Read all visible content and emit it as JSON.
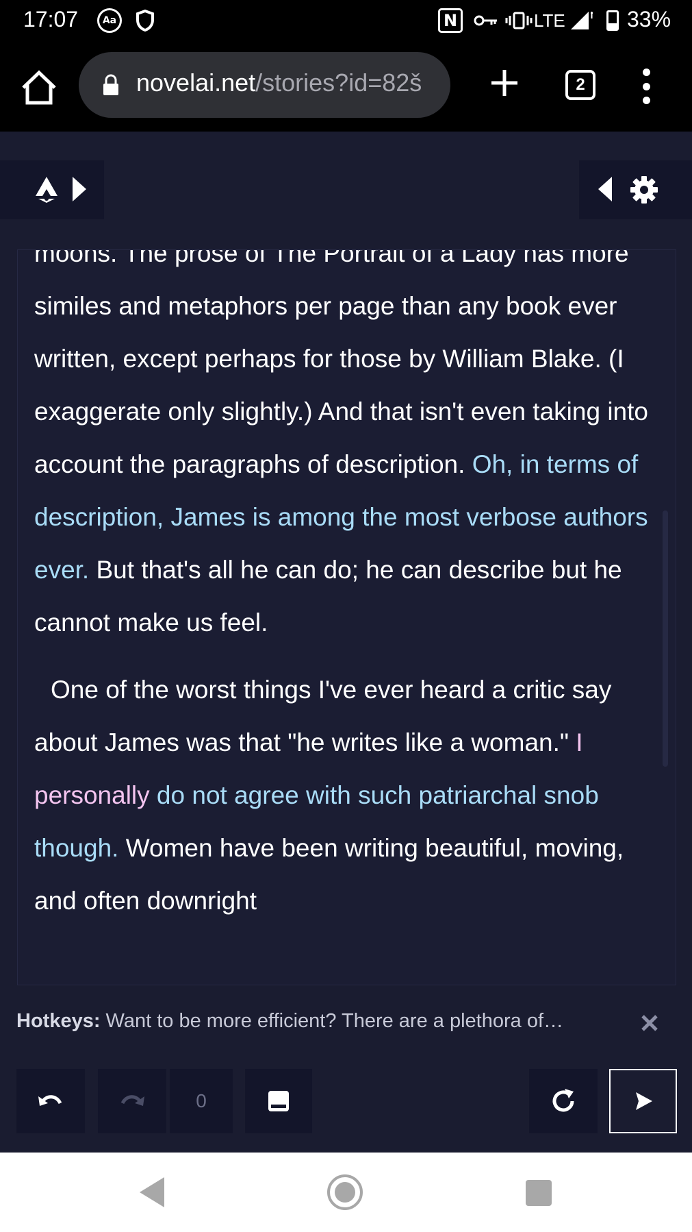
{
  "status_bar": {
    "time": "17:07",
    "network": "LTE",
    "battery_percent": "33%",
    "battery_level": 0.33,
    "icons": [
      "text-size-icon",
      "shield-icon",
      "nfc-icon",
      "vpn-key-icon",
      "vibrate-icon",
      "signal-icon",
      "battery-icon"
    ]
  },
  "browser": {
    "url_host": "novelai.net",
    "url_path": "/stories?id=82š",
    "tab_count": "2",
    "icons": [
      "home-icon",
      "lock-icon",
      "plus-icon",
      "tabs-icon",
      "more-vert-icon"
    ]
  },
  "story": {
    "p1_a": "moons. The prose of The Portrait of a Lady has more similes and metaphors per page than any book ever written, except perhaps for those by William Blake. (I exaggerate only slightly.) And that isn't even taking into account the paragraphs of description. ",
    "p1_ai": "Oh, in terms of description, James is among the most verbose authors ever.",
    "p1_b": " But that's all he can do; he can describe but he cannot make us feel.",
    "p2_a": "One of the worst things I've ever heard a critic say about James was that \"he writes like a woman.\" ",
    "p2_edit": "I personally",
    "p2_ai": " do not agree with such patriarchal snob though.",
    "p2_b": " Women have been writing beautiful, moving, and often downright"
  },
  "tip": {
    "label": "Hotkeys:",
    "text": " Want to be more efficient? There are a plethora of…"
  },
  "controls": {
    "token_count": "0"
  },
  "colors": {
    "background": "#1a1c30",
    "panel": "#13152a",
    "ai_text": "#a9dcf7",
    "edited_text": "#f3c4ef"
  }
}
